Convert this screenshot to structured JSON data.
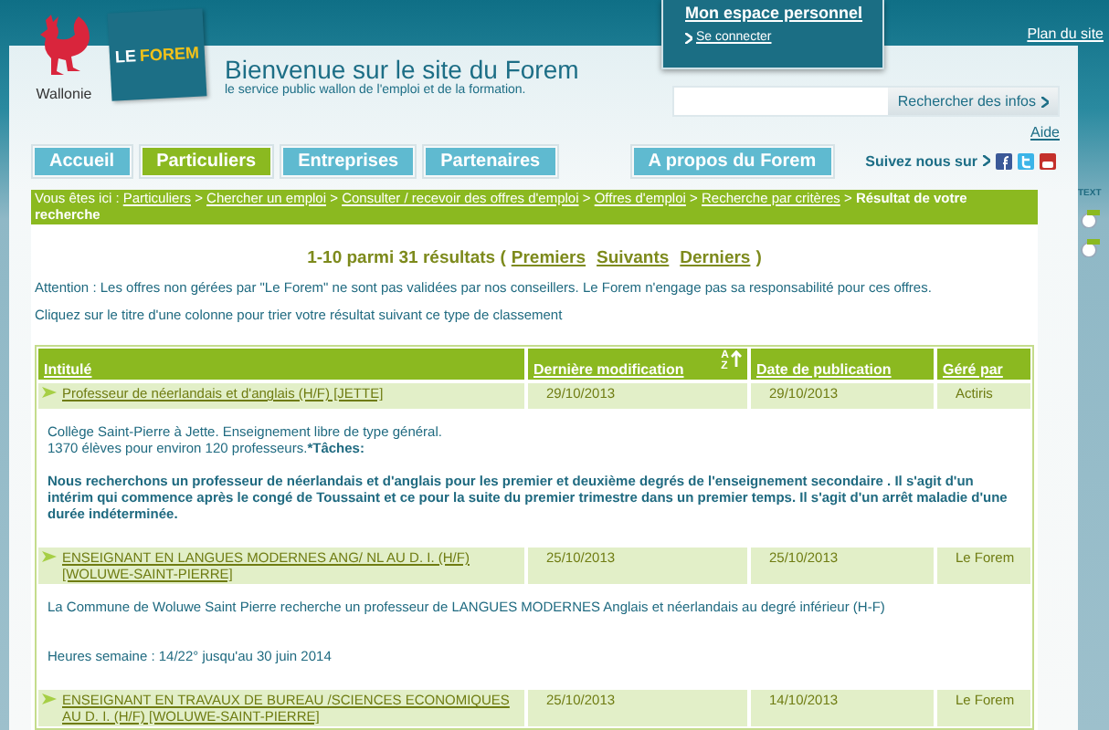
{
  "header": {
    "region_label": "Wallonie",
    "logo_words": [
      "LE",
      "FOREM"
    ],
    "title": "Bienvenue sur le site du Forem",
    "subtitle": "le service public wallon de l'emploi et de la formation.",
    "account": {
      "title": "Mon espace personnel",
      "link": "Se connecter"
    },
    "site_map": "Plan du site",
    "search": {
      "button": "Rechercher des infos"
    },
    "help": "Aide"
  },
  "tabs": [
    {
      "label": "Accueil",
      "selected": false
    },
    {
      "label": "Particuliers",
      "selected": true
    },
    {
      "label": "Entreprises",
      "selected": false
    },
    {
      "label": "Partenaires",
      "selected": false
    }
  ],
  "about_tab": {
    "label": "A propos du Forem",
    "selected": false
  },
  "social": {
    "label": "Suivez nous sur"
  },
  "side_tab": "TEXT",
  "breadcrumb": {
    "prefix": "Vous êtes ici :",
    "separator": ">",
    "items": [
      "Particuliers",
      "Chercher un emploi",
      "Consulter / recevoir des offres d'emploi",
      "Offres d'emploi",
      "Recherche par critères"
    ],
    "current": "Résultat de votre recherche"
  },
  "pagination": {
    "summary": "1-10 parmi 31 résultats (",
    "links": [
      "Premiers",
      "Suivants",
      "Derniers"
    ],
    "close": ")"
  },
  "notices": [
    "Attention : Les offres non gérées par \"Le Forem\" ne sont pas validées par nos conseillers. Le Forem n'engage pas sa responsabilité pour ces offres.",
    "Cliquez sur le titre d'une colonne pour trier votre résultat suivant ce type de classement"
  ],
  "table": {
    "columns": [
      {
        "label": "Intitulé",
        "sorted": false
      },
      {
        "label": "Dernière modification",
        "sorted": true,
        "sort_letters": [
          "A",
          "Z"
        ]
      },
      {
        "label": "Date de publication",
        "sorted": false
      },
      {
        "label": "Géré par",
        "sorted": false
      }
    ],
    "rows": [
      {
        "title": "Professeur de néerlandais et d'anglais (H/F) [JETTE]",
        "modified": "29/10/2013",
        "published": "29/10/2013",
        "managed_by": "Actiris",
        "description": [
          {
            "kind": "plain",
            "lines": [
              "Collège Saint-Pierre à Jette. Enseignement libre de type général.",
              "1370 élèves pour environ 120 professeurs.***Tâches:**"
            ]
          },
          {
            "kind": "bold",
            "lines": [
              "Nous recherchons un professeur de néerlandais et d'anglais pour les premier et deuxième degrés de l'enseignement secondaire . Il s'agit d'un intérim qui commence après le congé de Toussaint et ce pour la suite du premier trimestre dans un premier temps. Il s'agit d'un arrêt maladie d'une durée indéterminée."
            ]
          }
        ]
      },
      {
        "title": "ENSEIGNANT EN LANGUES MODERNES ANG/ NL AU D. I. (H/F) [WOLUWE-SAINT-PIERRE]",
        "modified": "25/10/2013",
        "published": "25/10/2013",
        "managed_by": "Le Forem",
        "description": [
          {
            "kind": "plain",
            "lines": [
              "La Commune de Woluwe Saint Pierre recherche un professeur de LANGUES MODERNES Anglais et néerlandais au degré inférieur (H-F)"
            ]
          },
          {
            "kind": "plain",
            "lines": [
              "Heures semaine : 14/22° jusqu'au 30 juin 2014"
            ]
          }
        ]
      },
      {
        "title": "ENSEIGNANT EN TRAVAUX DE BUREAU /SCIENCES ECONOMIQUES AU D. I. (H/F) [WOLUWE-SAINT-PIERRE]",
        "modified": "25/10/2013",
        "published": "14/10/2013",
        "managed_by": "Le Forem",
        "description": []
      }
    ]
  }
}
